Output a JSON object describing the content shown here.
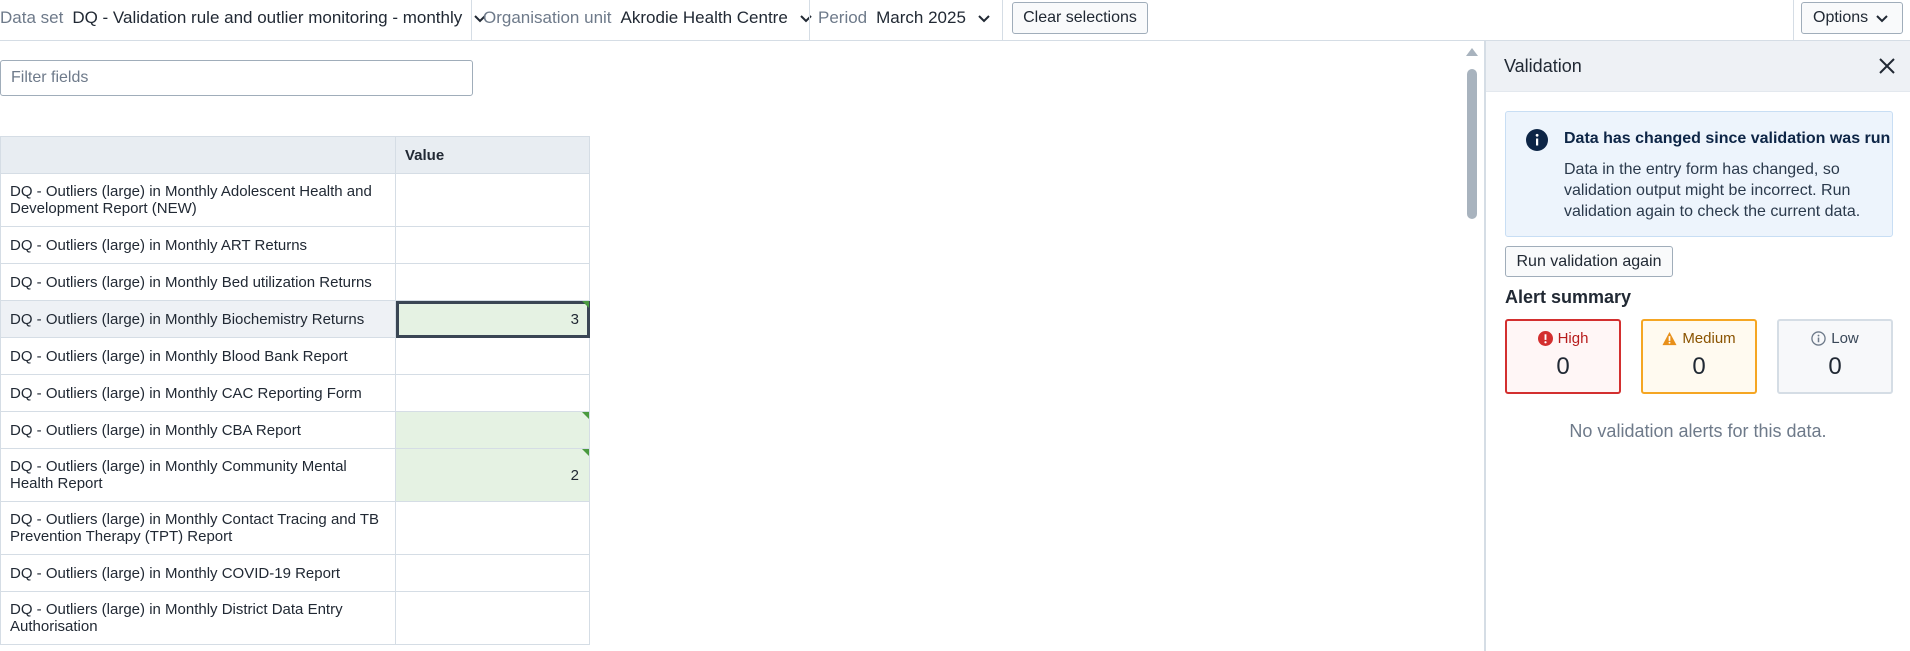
{
  "topbar": {
    "dataset_label": "Data set",
    "dataset_value": "DQ - Validation rule and outlier monitoring - monthly",
    "orgunit_label": "Organisation unit",
    "orgunit_value": "Akrodie Health Centre",
    "period_label": "Period",
    "period_value": "March 2025",
    "clear_label": "Clear selections",
    "options_label": "Options"
  },
  "filter": {
    "placeholder": "Filter fields"
  },
  "table": {
    "header_name": "",
    "header_value": "Value",
    "rows": [
      {
        "name": "DQ - Outliers (large) in Monthly Adolescent Health and Development Report (NEW)",
        "value": ""
      },
      {
        "name": "DQ - Outliers (large) in Monthly ART Returns",
        "value": ""
      },
      {
        "name": "DQ - Outliers (large) in Monthly Bed utilization Returns",
        "value": ""
      },
      {
        "name": "DQ - Outliers (large) in Monthly Biochemistry Returns",
        "value": "3"
      },
      {
        "name": "DQ - Outliers (large) in Monthly Blood Bank Report",
        "value": ""
      },
      {
        "name": "DQ - Outliers (large) in Monthly CAC Reporting Form",
        "value": ""
      },
      {
        "name": "DQ - Outliers (large) in Monthly CBA Report",
        "value": ""
      },
      {
        "name": "DQ - Outliers (large) in Monthly Community Mental Health Report",
        "value": "2"
      },
      {
        "name": "DQ - Outliers (large) in Monthly Contact Tracing and TB Prevention Therapy (TPT) Report",
        "value": ""
      },
      {
        "name": "DQ - Outliers (large) in Monthly COVID-19 Report",
        "value": ""
      },
      {
        "name": "DQ - Outliers (large) in Monthly District Data Entry Authorisation",
        "value": ""
      }
    ]
  },
  "panel": {
    "title": "Validation",
    "notice_title": "Data has changed since validation was run",
    "notice_body": "Data in the entry form has changed, so validation output might be incorrect. Run validation again to check the current data.",
    "run_again_label": "Run validation again",
    "alert_summary_label": "Alert summary",
    "cards": {
      "high": {
        "label": "High",
        "count": "0"
      },
      "medium": {
        "label": "Medium",
        "count": "0"
      },
      "low": {
        "label": "Low",
        "count": "0"
      }
    },
    "no_alerts_text": "No validation alerts for this data."
  },
  "colors": {
    "high": "#d32f2f",
    "medium": "#f5a623",
    "low": "#d5dde5",
    "filled_cell": "#e5f2e3",
    "synced_marker": "#4a9a3f",
    "info": "#0d2546"
  },
  "icons": [
    "chevron-down-icon",
    "close-icon",
    "info-icon",
    "error-icon",
    "warning-icon",
    "info-outline-icon"
  ]
}
